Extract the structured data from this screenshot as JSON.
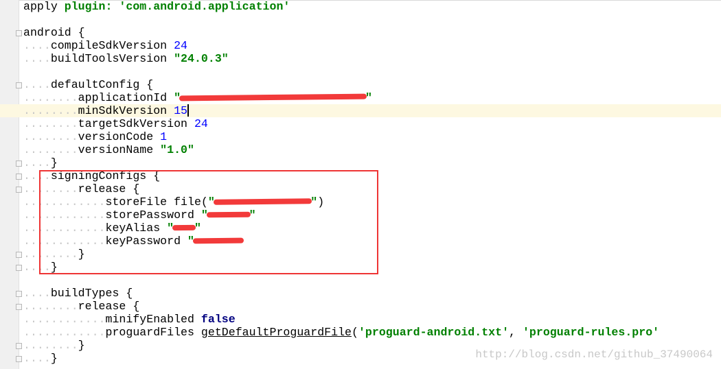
{
  "editor": {
    "current_line": 8,
    "lines": [
      [
        [
          "plain",
          "apply "
        ],
        [
          "str",
          "plugin: 'com.android.application'"
        ]
      ],
      [],
      [
        [
          "plain",
          "android {"
        ]
      ],
      [
        [
          "dots",
          "...."
        ],
        [
          "plain",
          "compileSdkVersion "
        ],
        [
          "num",
          "24"
        ]
      ],
      [
        [
          "dots",
          "...."
        ],
        [
          "plain",
          "buildToolsVersion "
        ],
        [
          "str",
          "\"24.0.3\""
        ]
      ],
      [],
      [
        [
          "dots",
          "...."
        ],
        [
          "plain",
          "defaultConfig {"
        ]
      ],
      [
        [
          "dots",
          "........"
        ],
        [
          "plain",
          "applicationId "
        ],
        [
          "str",
          "\""
        ],
        [
          "redacted",
          "                           "
        ],
        [
          "str",
          "\""
        ]
      ],
      [
        [
          "dots",
          "........"
        ],
        [
          "plain",
          "minSdkVersion "
        ],
        [
          "num",
          "15"
        ],
        [
          "caret",
          ""
        ]
      ],
      [
        [
          "dots",
          "........"
        ],
        [
          "plain",
          "targetSdkVersion "
        ],
        [
          "num",
          "24"
        ]
      ],
      [
        [
          "dots",
          "........"
        ],
        [
          "plain",
          "versionCode "
        ],
        [
          "num",
          "1"
        ]
      ],
      [
        [
          "dots",
          "........"
        ],
        [
          "plain",
          "versionName "
        ],
        [
          "str",
          "\"1.0\""
        ]
      ],
      [
        [
          "dots",
          "...."
        ],
        [
          "plain",
          "}"
        ]
      ],
      [
        [
          "dots",
          "...."
        ],
        [
          "plain",
          "signingConfigs {"
        ]
      ],
      [
        [
          "dots",
          "........"
        ],
        [
          "plain",
          "release {"
        ]
      ],
      [
        [
          "dots",
          "............"
        ],
        [
          "plain",
          "storeFile file("
        ],
        [
          "str",
          "\""
        ],
        [
          "redacted",
          "              "
        ],
        [
          "str",
          "\""
        ],
        [
          "plain",
          ")"
        ]
      ],
      [
        [
          "dots",
          "............"
        ],
        [
          "plain",
          "storePassword "
        ],
        [
          "str",
          "\""
        ],
        [
          "redacted",
          "      "
        ],
        [
          "str",
          "\""
        ]
      ],
      [
        [
          "dots",
          "............"
        ],
        [
          "plain",
          "keyAlias "
        ],
        [
          "str",
          "\""
        ],
        [
          "redacted",
          "   "
        ],
        [
          "str",
          "\""
        ]
      ],
      [
        [
          "dots",
          "............"
        ],
        [
          "plain",
          "keyPassword "
        ],
        [
          "str",
          "\""
        ],
        [
          "redacted",
          "       "
        ]
      ],
      [
        [
          "dots",
          "........"
        ],
        [
          "plain",
          "}"
        ]
      ],
      [
        [
          "dots",
          "...."
        ],
        [
          "plain",
          "}"
        ]
      ],
      [],
      [
        [
          "dots",
          "...."
        ],
        [
          "plain",
          "buildTypes {"
        ]
      ],
      [
        [
          "dots",
          "........"
        ],
        [
          "plain",
          "release {"
        ]
      ],
      [
        [
          "dots",
          "............"
        ],
        [
          "plain",
          "minifyEnabled "
        ],
        [
          "kw",
          "false"
        ]
      ],
      [
        [
          "dots",
          "............"
        ],
        [
          "plain",
          "proguardFiles "
        ],
        [
          "fn",
          "getDefaultProguardFile"
        ],
        [
          "plain",
          "("
        ],
        [
          "str",
          "'proguard-android.txt'"
        ],
        [
          "plain",
          ", "
        ],
        [
          "str",
          "'proguard-rules.pro'"
        ]
      ],
      [
        [
          "dots",
          "........"
        ],
        [
          "plain",
          "}"
        ]
      ],
      [
        [
          "dots",
          "...."
        ],
        [
          "plain",
          "}"
        ]
      ]
    ]
  },
  "watermark": "http://blog.csdn.net/github_37490064",
  "colors": {
    "string": "#008000",
    "number": "#0000ff",
    "keyword": "#000080",
    "highlight_box": "#ee3434",
    "current_line": "#fdf8e1"
  }
}
